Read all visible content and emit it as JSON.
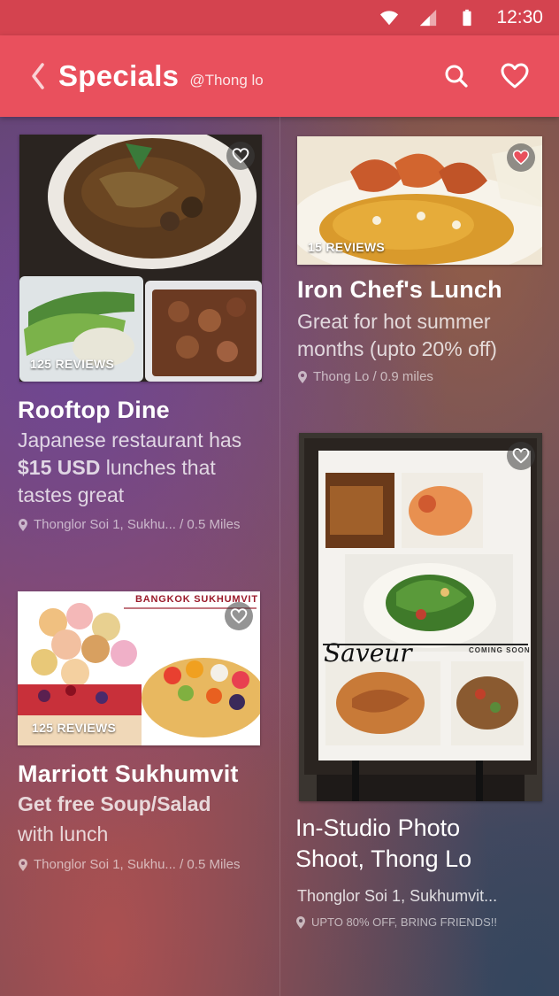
{
  "status_bar": {
    "time": "12:30"
  },
  "app_bar": {
    "title": "Specials",
    "subtitle": "@Thong lo"
  },
  "cards": [
    {
      "reviews": "125 REVIEWS",
      "title": "Rooftop Dine",
      "desc_pre": "Japanese restaurant has ",
      "desc_bold": "$15 USD",
      "desc_post": " lunches that tastes great",
      "location": "Thonglor Soi 1, Sukhu... / 0.5 Miles",
      "favorited": false
    },
    {
      "reviews": "15 REVIEWS",
      "title": "Iron Chef's Lunch",
      "desc": "Great for hot summer months (upto 20% off)",
      "location": "Thong Lo / 0.9 miles",
      "favorited": true
    },
    {
      "reviews": "125 REVIEWS",
      "banner_text": "BANGKOK SUKHUMVIT",
      "title": "Marriott Sukhumvit",
      "desc_line1": "Get free Soup/Salad",
      "desc_line2": "with lunch",
      "location": "Thonglor Soi 1, Sukhu... / 0.5 Miles",
      "favorited": false
    },
    {
      "title": "In-Studio Photo Shoot, Thong Lo",
      "subtitle": "Thonglor Soi 1, Sukhumvit...",
      "location": "UPTO 80% OFF, BRING FRIENDS!!",
      "poster_logo": "Saveur",
      "poster_tag": "COMING SOON",
      "favorited": false
    }
  ],
  "colors": {
    "status_bar": "#d4434f",
    "app_bar": "#e9505d",
    "heart_active": "#e9505d"
  },
  "icons": [
    "wifi-icon",
    "signal-icon",
    "battery-icon",
    "back-chevron-icon",
    "search-icon",
    "heart-outline-icon",
    "heart-filled-icon",
    "location-pin-icon"
  ]
}
